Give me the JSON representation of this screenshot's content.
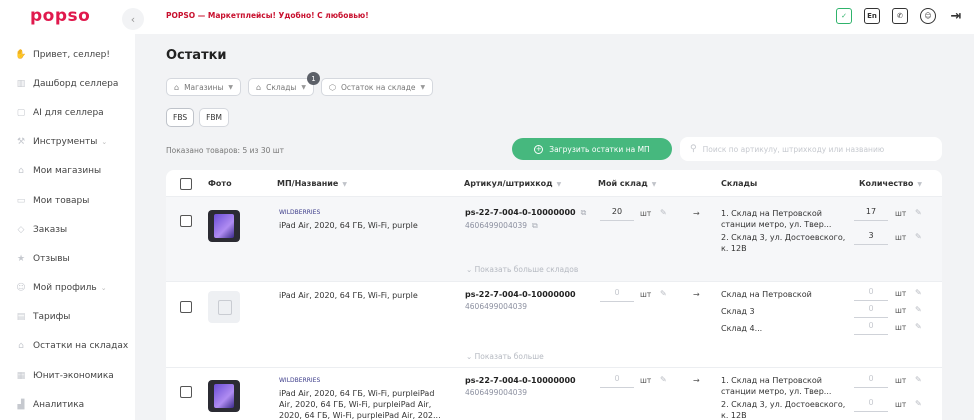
{
  "app": {
    "logo": "popso",
    "collapse_icon": "chevron-left-icon"
  },
  "sidebar": {
    "items": [
      {
        "label": "Привет, селлер!",
        "icon": "hand-icon",
        "chevron": ""
      },
      {
        "label": "Дашборд селлера",
        "icon": "bar-chart-icon",
        "chevron": ""
      },
      {
        "label": "AI для селлера",
        "icon": "ai-icon",
        "chevron": ""
      },
      {
        "label": "Инструменты",
        "icon": "tools-icon",
        "chevron": "⌄"
      },
      {
        "label": "Мои магазины",
        "icon": "store-icon",
        "chevron": ""
      },
      {
        "label": "Мои товары",
        "icon": "box-icon",
        "chevron": ""
      },
      {
        "label": "Заказы",
        "icon": "tag-icon",
        "chevron": ""
      },
      {
        "label": "Отзывы",
        "icon": "star-icon",
        "chevron": ""
      },
      {
        "label": "Мой профиль",
        "icon": "user-icon",
        "chevron": "⌄"
      },
      {
        "label": "Тарифы",
        "icon": "wallet-icon",
        "chevron": ""
      },
      {
        "label": "Остатки на складах",
        "icon": "warehouse-icon",
        "chevron": ""
      },
      {
        "label": "Юнит-экономика",
        "icon": "calculator-icon",
        "chevron": ""
      },
      {
        "label": "Аналитика",
        "icon": "analytics-icon",
        "chevron": ""
      }
    ]
  },
  "topbar": {
    "announcement": "POPSO — Маркетплейсы! Удобно! С любовью!",
    "icons": [
      "checkbox-icon",
      "language-icon",
      "phone-icon",
      "profile-icon",
      "logout-icon"
    ],
    "lang_label": "En"
  },
  "main": {
    "title": "Остатки",
    "filters": [
      {
        "label": "Магазины",
        "icon": "store-icon"
      },
      {
        "label": "Склады",
        "icon": "warehouse-icon",
        "badge": "1"
      },
      {
        "label": "Остаток на складе",
        "icon": "box-icon"
      }
    ],
    "tabs": [
      "FBS",
      "FBM"
    ],
    "shown_text": "Показано товаров: 5 из 30 шт",
    "upload_button": "Загрузить остатки на МП",
    "search_placeholder": "Поиск по артикулу, штрихкоду или названию"
  },
  "table": {
    "headers": {
      "photo": "Фото",
      "name": "МП/Название",
      "sku": "Артикул/штрихкод",
      "my_warehouse": "Мой склад",
      "warehouses": "Склады",
      "quantity": "Количество"
    },
    "unit": "шт",
    "rows": [
      {
        "brand": "WILDBERRIES",
        "name": "iPad Air, 2020, 64 ГБ, Wi-Fi, purple",
        "sku": "ps-22-7-004-0-10000000",
        "barcode": "4606499004039",
        "my_qty": "20",
        "warehouses": [
          {
            "name": "1. Склад на Петровской станции метро, ул. Твер...",
            "qty": "17"
          },
          {
            "name": "2. Склад 3, ул. Достоевского, к. 12В",
            "qty": "3"
          }
        ],
        "more": "Показать больше складов"
      },
      {
        "brand": "",
        "name": "iPad Air, 2020, 64 ГБ, Wi-Fi, purple",
        "sku": "ps-22-7-004-0-10000000",
        "barcode": "4606499004039",
        "my_qty": "0",
        "warehouses": [
          {
            "name": "Склад на Петровской",
            "qty": "0"
          },
          {
            "name": "Склад 3",
            "qty": "0"
          },
          {
            "name": "Склад 4...",
            "qty": "0"
          }
        ],
        "more": "Показать больше"
      },
      {
        "brand": "WILDBERRIES",
        "name": "iPad Air, 2020, 64 ГБ, Wi-Fi, purpleiPad Air, 2020, 64 ГБ, Wi-Fi, purpleiPad Air, 2020, 64 ГБ, Wi-Fi, purpleiPad Air, 202...",
        "sku": "ps-22-7-004-0-10000000",
        "barcode": "4606499004039",
        "my_qty": "0",
        "warehouses": [
          {
            "name": "1. Склад на Петровской станции метро, ул. Твер...",
            "qty": "0"
          },
          {
            "name": "2. Склад 3, ул. Достоевского, к. 12В",
            "qty": "0"
          }
        ],
        "more": ""
      }
    ]
  }
}
